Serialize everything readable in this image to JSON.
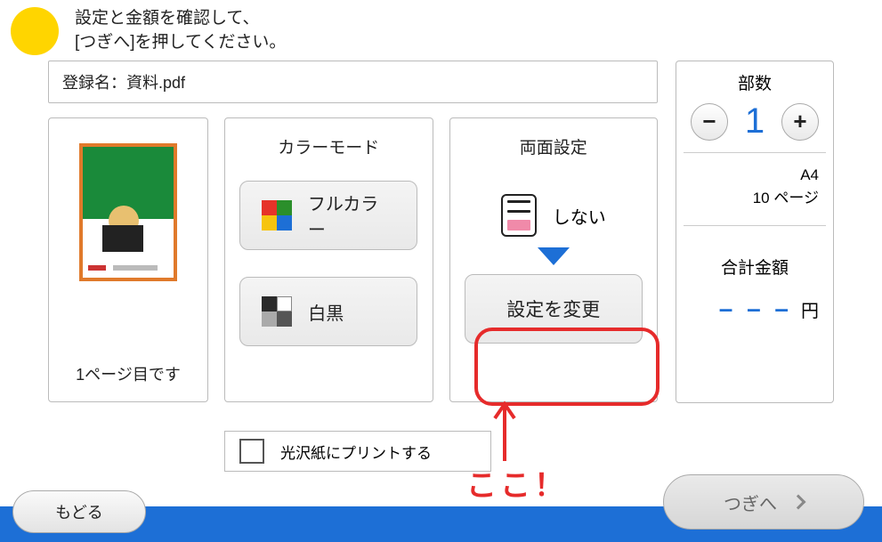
{
  "header": {
    "line1": "設定と金額を確認して、",
    "line2": "[つぎへ]を押してください。"
  },
  "filename": {
    "label": "登録名：",
    "value": "資料.pdf"
  },
  "preview": {
    "caption": "1ページ目です"
  },
  "color_mode": {
    "title": "カラーモード",
    "full_color": "フルカラー",
    "bw": "白黒"
  },
  "duplex": {
    "title": "両面設定",
    "none": "しない",
    "change": "設定を変更"
  },
  "copies": {
    "title": "部数",
    "value": "1",
    "paper_size": "A4",
    "page_count": "10 ページ",
    "total_label": "合計金額",
    "total_value": "– – –",
    "currency": "円"
  },
  "glossy": {
    "label": "光沢紙にプリントする"
  },
  "buttons": {
    "back": "もどる",
    "next": "つぎへ"
  },
  "annotation": {
    "text": "ここ！"
  }
}
